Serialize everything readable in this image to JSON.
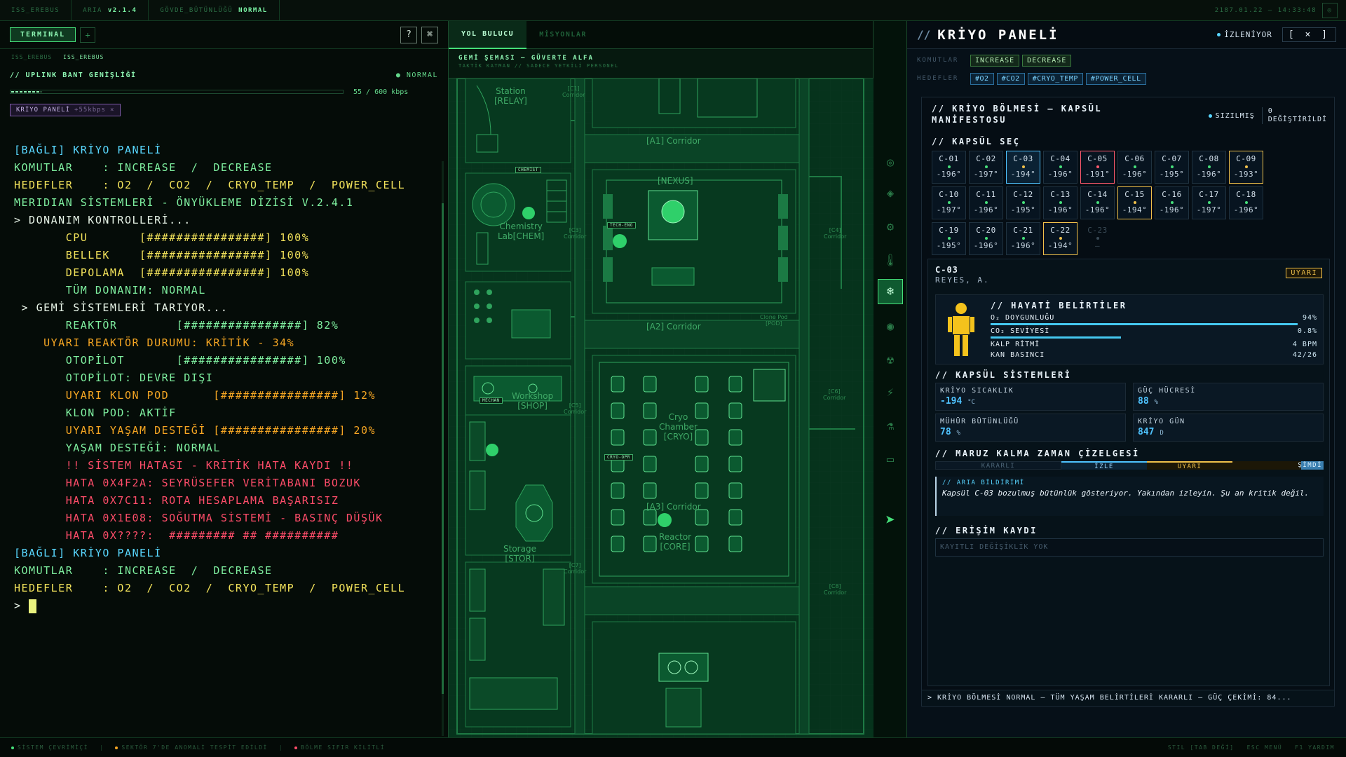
{
  "topbar": {
    "items": [
      {
        "label": "ISS_EREBUS",
        "value": ""
      },
      {
        "label": "ARIA",
        "value": "v2.1.4"
      },
      {
        "label": "GÖVDE_BÜTÜNLÜĞÜ",
        "value": "NORMAL"
      }
    ],
    "clock": "2187.01.22 — 14:33:48"
  },
  "terminal": {
    "tab_label": "TERMINAL",
    "add_tab": "+",
    "tool_help": "?",
    "tool_cmd": "⌘",
    "subtabs": [
      "ISS_EREBUS",
      "ISS_EREBUS"
    ],
    "uplink_title": "// UPLINK BANT GENİŞLİĞİ",
    "uplink_status": "● NORMAL",
    "uplink_rate": "55 / 600 kbps",
    "uplink_fraction": 0.09,
    "attach_label": "KRİYO PANELİ",
    "attach_rate": "+55kbps",
    "attach_close": "×",
    "lines": [
      {
        "text": "[BAĞLI] KRİYO PANELİ",
        "color": "cyan"
      },
      {
        "text": "KOMUTLAR    : INCREASE  /  DECREASE",
        "color": "green"
      },
      {
        "text": "HEDEFLER    : O2  /  CO2  /  CRYO_TEMP  /  POWER_CELL",
        "color": "yellow"
      },
      {
        "text": "MERIDIAN SİSTEMLERİ - ÖNYÜKLEME DİZİSİ V.2.4.1",
        "color": "green"
      },
      {
        "text": "> DONANIM KONTROLLERİ...",
        "color": "white"
      },
      {
        "text": "       CPU       [################] 100%",
        "color": "yellow"
      },
      {
        "text": "       BELLEK    [################] 100%",
        "color": "yellow"
      },
      {
        "text": "       DEPOLAMA  [################] 100%",
        "color": "yellow"
      },
      {
        "text": "       TÜM DONANIM: NORMAL",
        "color": "green"
      },
      {
        "text": " > GEMİ SİSTEMLERİ TARIYOR...",
        "color": "white"
      },
      {
        "text": "       REAKTÖR        [################] 82%",
        "color": "green"
      },
      {
        "text": "    UYARI REAKTÖR DURUMU: KRİTİK - 34%",
        "color": "orange"
      },
      {
        "text": "       OTOPİLOT       [################] 100%",
        "color": "green"
      },
      {
        "text": "       OTOPİLOT: DEVRE DIŞI",
        "color": "green"
      },
      {
        "text": "       UYARI KLON POD      [################] 12%",
        "color": "orange"
      },
      {
        "text": "       KLON POD: AKTİF",
        "color": "green"
      },
      {
        "text": "       UYARI YAŞAM DESTEĞİ [################] 20%",
        "color": "orange"
      },
      {
        "text": "       YAŞAM DESTEĞİ: NORMAL",
        "color": "green"
      },
      {
        "text": "       !! SİSTEM HATASI - KRİTİK HATA KAYDI !!",
        "color": "red"
      },
      {
        "text": "       HATA 0X4F2A: SEYRÜSEFER VERİTABANI BOZUK",
        "color": "red"
      },
      {
        "text": "       HATA 0X7C11: ROTA HESAPLAMA BAŞARISIZ",
        "color": "red"
      },
      {
        "text": "       HATA 0X1E08: SOĞUTMA SİSTEMİ - BASINÇ DÜŞÜK",
        "color": "red"
      },
      {
        "text": "       HATA 0X????:  ######### ## ##########",
        "color": "red"
      },
      {
        "text": "[BAĞLI] KRİYO PANELİ",
        "color": "cyan"
      },
      {
        "text": "KOMUTLAR    : INCREASE  /  DECREASE",
        "color": "green"
      },
      {
        "text": "HEDEFLER    : O2  /  CO2  /  CRYO_TEMP  /  POWER_CELL",
        "color": "yellow"
      }
    ],
    "prompt": ">"
  },
  "map": {
    "tabs": [
      "YOL BULUCU",
      "MİSYONLAR"
    ],
    "header_title": "GEMİ ŞEMASI — GÜVERTE ALFA",
    "header_sub": "TAKTİK KATMAN // SADECE YETKİLİ PERSONEL",
    "labels": {
      "station": "Station\n[RELAY]",
      "c1": "[C1]\nCorridor",
      "a1": "[A1] Corridor",
      "nexus": "[NEXUS]",
      "chem": "Chemistry\nLab[CHEM]",
      "c3": "[C3]\nCorridor",
      "c4": "[C4]\nCorridor",
      "a2": "[A2] Corridor",
      "workshop": "Workshop\n[SHOP]",
      "c5": "[C5]\nCorridor",
      "clone": "Clone Pod\n[POD]",
      "cryo": "Cryo\nChamber\n[CRYO]",
      "c6": "[C6]\nCorridor",
      "a3": "[A3] Corridor",
      "storage": "Storage\n[STOR]",
      "c7": "[C7]\nCorridor",
      "reactor": "Reactor\n[CORE]",
      "c8": "[C8]\nCorridor"
    },
    "tags": {
      "chemist": "CHEMIST",
      "tech": "TECH-ENG",
      "mechanic": "MECHAN",
      "cryo": "CRYO-OPR"
    }
  },
  "rail_icons": [
    "target-icon",
    "diamond-icon",
    "gear-icon",
    "thermometer-icon",
    "snowflake-icon",
    "radar-icon",
    "radiation-icon",
    "lightning-icon",
    "flask-icon",
    "folder-icon"
  ],
  "panel": {
    "title": "KRİYO PANELİ",
    "slash": "//",
    "watching": "İZLENİYOR",
    "close": "[ × ]",
    "commands_label": "KOMUTLAR",
    "commands": [
      "INCREASE",
      "DECREASE"
    ],
    "targets_label": "HEDEFLER",
    "targets": [
      "#O2",
      "#CO2",
      "#CRYO_TEMP",
      "#POWER_CELL"
    ],
    "manifest_title": "// KRİYO BÖLMESİ — KAPSÜL MANİFESTOSU",
    "leak_label": "SIZILMIŞ",
    "modified_count": "0",
    "modified_label": "DEĞİŞTİRİLDİ",
    "pod_select_title": "// KAPSÜL SEÇ",
    "pods": [
      {
        "id": "C-01",
        "temp": "-196°",
        "status": "ok"
      },
      {
        "id": "C-02",
        "temp": "-197°",
        "status": "ok"
      },
      {
        "id": "C-03",
        "temp": "-194°",
        "status": "selected"
      },
      {
        "id": "C-04",
        "temp": "-196°",
        "status": "ok"
      },
      {
        "id": "C-05",
        "temp": "-191°",
        "status": "critical"
      },
      {
        "id": "C-06",
        "temp": "-196°",
        "status": "ok"
      },
      {
        "id": "C-07",
        "temp": "-195°",
        "status": "ok"
      },
      {
        "id": "C-08",
        "temp": "-196°",
        "status": "ok"
      },
      {
        "id": "C-09",
        "temp": "-193°",
        "status": "warning"
      },
      {
        "id": "C-10",
        "temp": "-197°",
        "status": "ok"
      },
      {
        "id": "C-11",
        "temp": "-196°",
        "status": "ok"
      },
      {
        "id": "C-12",
        "temp": "-195°",
        "status": "ok"
      },
      {
        "id": "C-13",
        "temp": "-196°",
        "status": "ok"
      },
      {
        "id": "C-14",
        "temp": "-196°",
        "status": "ok"
      },
      {
        "id": "C-15",
        "temp": "-194°",
        "status": "warning"
      },
      {
        "id": "C-16",
        "temp": "-196°",
        "status": "ok"
      },
      {
        "id": "C-17",
        "temp": "-197°",
        "status": "ok"
      },
      {
        "id": "C-18",
        "temp": "-196°",
        "status": "ok"
      },
      {
        "id": "C-19",
        "temp": "-195°",
        "status": "ok"
      },
      {
        "id": "C-20",
        "temp": "-196°",
        "status": "ok"
      },
      {
        "id": "C-21",
        "temp": "-196°",
        "status": "ok"
      },
      {
        "id": "C-22",
        "temp": "-194°",
        "status": "warning"
      },
      {
        "id": "C-23",
        "temp": "—",
        "status": "offline"
      }
    ],
    "selected_pod": {
      "id": "C-03",
      "name": "REYES, A.",
      "badge": "UYARI"
    },
    "vitals_title": "// HAYATİ BELİRTİLER",
    "vitals": [
      {
        "label": "O₂ DOYGUNLUĞU",
        "value": "94%",
        "fraction": 0.94
      },
      {
        "label": "CO₂ SEVİYESİ",
        "value": "0.8%",
        "fraction": 0.4
      },
      {
        "label": "KALP RİTMİ",
        "value": "4 BPM"
      },
      {
        "label": "KAN BASINCI",
        "value": "42/26"
      }
    ],
    "systems_title": "// KAPSÜL SİSTEMLERİ",
    "systems": [
      {
        "label": "KRİYO SICAKLIK",
        "value": "-194",
        "unit": "°C"
      },
      {
        "label": "GÜÇ HÜCRESİ",
        "value": "88",
        "unit": "%"
      },
      {
        "label": "MÜHÜR BÜTÜNLÜĞÜ",
        "value": "78",
        "unit": "%"
      },
      {
        "label": "KRİYO GÜN",
        "value": "847",
        "unit": "D"
      }
    ],
    "exposure_title": "// MARUZ KALMA ZAMAN ÇİZELGESİ",
    "timeline": [
      "KARARLI",
      "İZLE",
      "UYARI",
      "ŞİMDİ"
    ],
    "alert_head": "// ARIA BİLDİRİMİ",
    "alert_msg": "Kapsül C-03 bozulmuş bütünlük gösteriyor. Yakından izleyin. Şu an kritik değil.",
    "access_title": "// ERİŞİM KAYDI",
    "access_empty": "KAYITLI DEĞİŞİKLİK YOK",
    "ticker": "> KRİYO BÖLMESİ NORMAL — TÜM YAŞAM BELİRTİLERİ KARARLI — GÜÇ ÇEKİMİ: 84..."
  },
  "footer": {
    "items": [
      {
        "text": "SİSTEM ÇEVRİMİÇİ",
        "color": "#46e07a"
      },
      {
        "text": "SEKTÖR 7'DE ANOMALİ TESPİT EDİLDİ",
        "color": "#f5a623"
      },
      {
        "text": "BÖLME SIFIR KİLİTLİ",
        "color": "#ff4d6a"
      }
    ],
    "right": [
      "STIL [TAB DEĞİ]",
      "ESC MENÜ",
      "F1 YARDIM"
    ]
  },
  "colors": {
    "accent": "#46e07a",
    "panel_accent": "#4fc3ff",
    "warn": "#f0c14b",
    "crit": "#ff5a6e"
  }
}
